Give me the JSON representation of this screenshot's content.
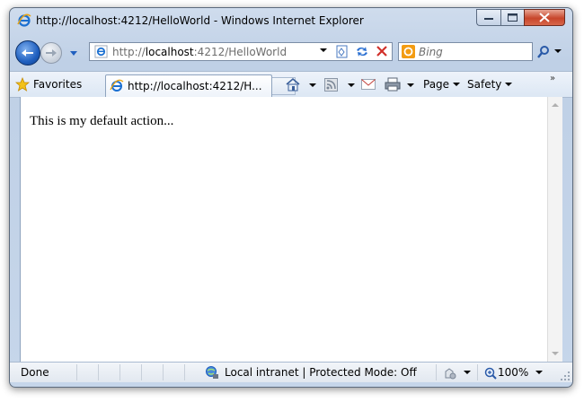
{
  "window": {
    "title": "http://localhost:4212/HelloWorld - Windows Internet Explorer"
  },
  "address": {
    "prefix": "http://",
    "host": "localhost",
    "rest": ":4212/HelloWorld"
  },
  "search": {
    "placeholder": "Bing"
  },
  "favorites": {
    "label": "Favorites"
  },
  "tab": {
    "label": "http://localhost:4212/H..."
  },
  "command_bar": {
    "page_label": "Page",
    "safety_label": "Safety"
  },
  "page": {
    "text": "This is my default action..."
  },
  "status": {
    "left_text": "Done",
    "zone_text": "Local intranet | Protected Mode: Off",
    "zoom": "100%"
  },
  "icons": {
    "back": "back-arrow-icon",
    "forward": "forward-arrow-icon",
    "ie": "ie-logo-icon",
    "compat": "compatibility-view-icon",
    "refresh": "refresh-icon",
    "stop": "stop-icon",
    "search": "search-icon",
    "favorites": "favorites-star-icon",
    "home": "home-icon",
    "feeds": "feeds-icon",
    "mail": "mail-icon",
    "print": "print-icon",
    "zone": "local-intranet-icon",
    "zoom": "zoom-icon"
  },
  "colors": {
    "accent_blue": "#1f5fbf",
    "close_red": "#c7462b",
    "bing_orange": "#f39c12"
  }
}
